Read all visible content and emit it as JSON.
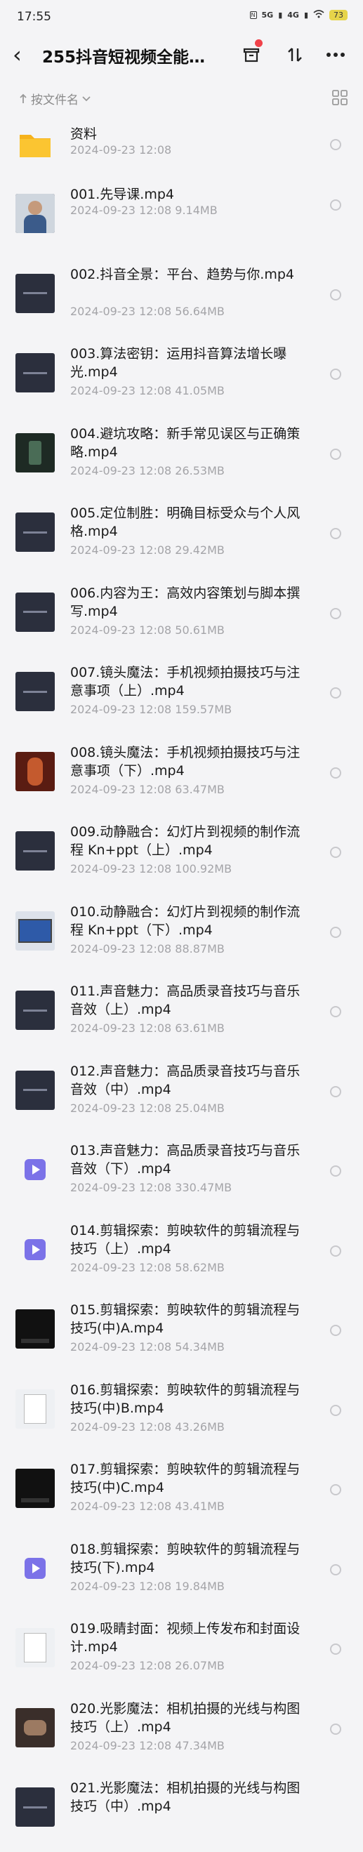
{
  "status_bar": {
    "time": "17:55",
    "network_1": "5G",
    "network_2": "4G",
    "battery": "73"
  },
  "header": {
    "title": "255抖音短视频全能…"
  },
  "sort": {
    "label": "按文件名"
  },
  "files": [
    {
      "name": "资料",
      "date": "2024-09-23",
      "time": "12:08",
      "size": "",
      "thumb": "folder"
    },
    {
      "name": "001.先导课.mp4",
      "date": "2024-09-23",
      "time": "12:08",
      "size": "9.14MB",
      "thumb": "person"
    },
    {
      "name": "002.抖音全景：平台、趋势与你.mp4",
      "date": "2024-09-23",
      "time": "12:08",
      "size": "56.64MB",
      "thumb": "dark"
    },
    {
      "name": "003.算法密钥：运用抖音算法增长曝光.mp4",
      "date": "2024-09-23",
      "time": "12:08",
      "size": "41.05MB",
      "thumb": "dark"
    },
    {
      "name": "004.避坑攻略：新手常见误区与正确策略.mp4",
      "date": "2024-09-23",
      "time": "12:08",
      "size": "26.53MB",
      "thumb": "phone"
    },
    {
      "name": "005.定位制胜：明确目标受众与个人风格.mp4",
      "date": "2024-09-23",
      "time": "12:08",
      "size": "29.42MB",
      "thumb": "dark"
    },
    {
      "name": "006.内容为王：高效内容策划与脚本撰写.mp4",
      "date": "2024-09-23",
      "time": "12:08",
      "size": "50.61MB",
      "thumb": "dark"
    },
    {
      "name": "007.镜头魔法：手机视频拍摄技巧与注意事项（上）.mp4",
      "date": "2024-09-23",
      "time": "12:08",
      "size": "159.57MB",
      "thumb": "dark"
    },
    {
      "name": "008.镜头魔法：手机视频拍摄技巧与注意事项（下）.mp4",
      "date": "2024-09-23",
      "time": "12:08",
      "size": "63.47MB",
      "thumb": "red"
    },
    {
      "name": "009.动静融合：幻灯片到视频的制作流程 Kn+ppt（上）.mp4",
      "date": "2024-09-23",
      "time": "12:08",
      "size": "100.92MB",
      "thumb": "dark"
    },
    {
      "name": "010.动静融合：幻灯片到视频的制作流程 Kn+ppt（下）.mp4",
      "date": "2024-09-23",
      "time": "12:08",
      "size": "88.87MB",
      "thumb": "screen"
    },
    {
      "name": "011.声音魅力：高品质录音技巧与音乐音效（上）.mp4",
      "date": "2024-09-23",
      "time": "12:08",
      "size": "63.61MB",
      "thumb": "dark"
    },
    {
      "name": "012.声音魅力：高品质录音技巧与音乐音效（中）.mp4",
      "date": "2024-09-23",
      "time": "12:08",
      "size": "25.04MB",
      "thumb": "dark"
    },
    {
      "name": "013.声音魅力：高品质录音技巧与音乐音效（下）.mp4",
      "date": "2024-09-23",
      "time": "12:08",
      "size": "330.47MB",
      "thumb": "video"
    },
    {
      "name": "014.剪辑探索：剪映软件的剪辑流程与技巧（上）.mp4",
      "date": "2024-09-23",
      "time": "12:08",
      "size": "58.62MB",
      "thumb": "video"
    },
    {
      "name": "015.剪辑探索：剪映软件的剪辑流程与技巧(中)A.mp4",
      "date": "2024-09-23",
      "time": "12:08",
      "size": "54.34MB",
      "thumb": "black"
    },
    {
      "name": "016.剪辑探索：剪映软件的剪辑流程与技巧(中)B.mp4",
      "date": "2024-09-23",
      "time": "12:08",
      "size": "43.26MB",
      "thumb": "doc"
    },
    {
      "name": "017.剪辑探索：剪映软件的剪辑流程与技巧(中)C.mp4",
      "date": "2024-09-23",
      "time": "12:08",
      "size": "43.41MB",
      "thumb": "black"
    },
    {
      "name": "018.剪辑探索：剪映软件的剪辑流程与技巧(下).mp4",
      "date": "2024-09-23",
      "time": "12:08",
      "size": "19.84MB",
      "thumb": "video"
    },
    {
      "name": "019.吸睛封面：视频上传发布和封面设计.mp4",
      "date": "2024-09-23",
      "time": "12:08",
      "size": "26.07MB",
      "thumb": "doc"
    },
    {
      "name": "020.光影魔法：相机拍摄的光线与构图技巧（上）.mp4",
      "date": "2024-09-23",
      "time": "12:08",
      "size": "47.34MB",
      "thumb": "hand"
    },
    {
      "name": "021.光影魔法：相机拍摄的光线与构图技巧（中）.mp4",
      "date": "",
      "time": "",
      "size": "",
      "thumb": "dark"
    }
  ]
}
